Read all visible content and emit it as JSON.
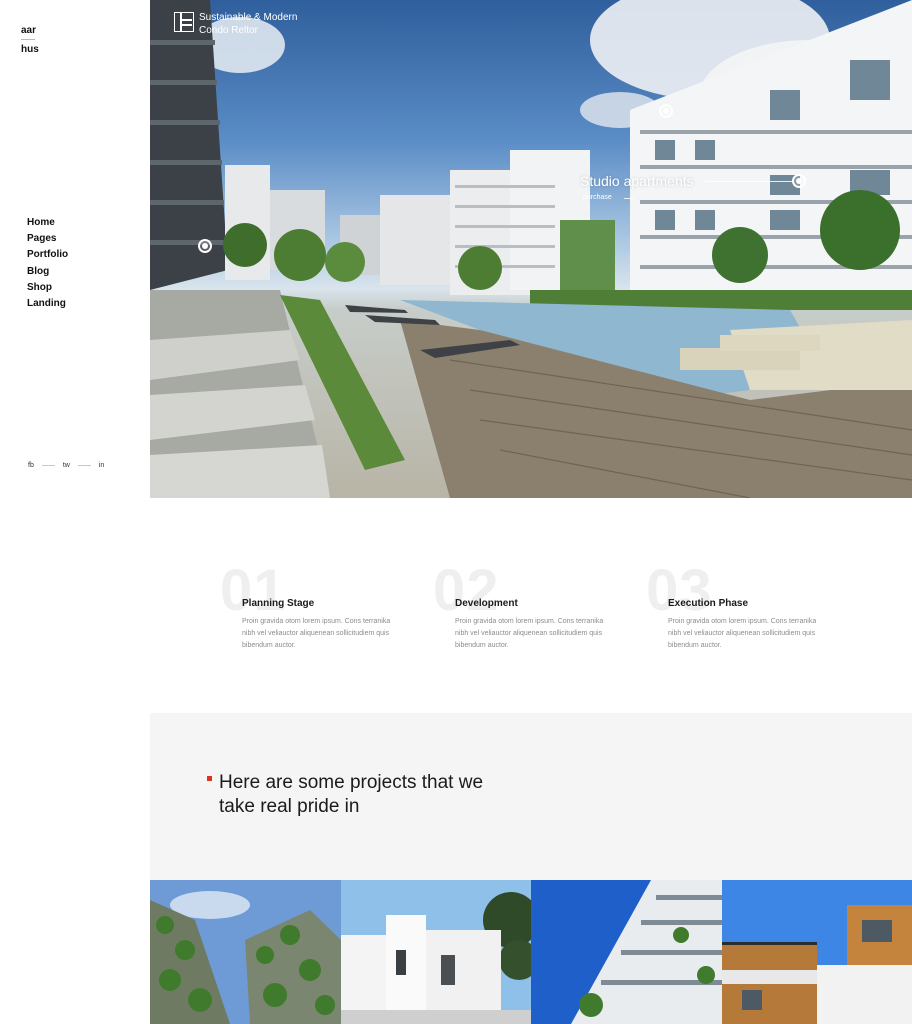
{
  "logo": {
    "line1": "aar",
    "line2": "hus"
  },
  "nav": {
    "items": [
      "Home",
      "Pages",
      "Portfolio",
      "Blog",
      "Shop",
      "Landing"
    ]
  },
  "social": {
    "items": [
      "fb",
      "tw",
      "in"
    ]
  },
  "hero": {
    "brand": "Sustainable & Modern Condo Reltor",
    "brand_icon": "building-plan-icon",
    "hotspot": {
      "title": "Studio apartments",
      "subtitle": "purchase"
    }
  },
  "steps": [
    {
      "number": "01",
      "title": "Planning Stage",
      "description": "Proin gravida otom lorem ipsum. Cons terranika nibh vel veliauctor aliquenean sollicitudiem quis bibendum auctor."
    },
    {
      "number": "02",
      "title": "Development",
      "description": "Proin gravida otom lorem ipsum. Cons terranika nibh vel veliauctor aliquenean sollicitudiem quis bibendum auctor."
    },
    {
      "number": "03",
      "title": "Execution Phase",
      "description": "Proin gravida otom lorem ipsum. Cons terranika nibh vel veliauctor aliquenean sollicitudiem quis bibendum auctor."
    }
  ],
  "projects": {
    "heading": "Here are some projects that we take real pride in",
    "accent": "#e0301e"
  },
  "colors": {
    "background": "#ffffff",
    "band": "#f5f5f5",
    "number": "#efefef",
    "text": "#1b1b1b",
    "muted": "#8c8c8c"
  }
}
